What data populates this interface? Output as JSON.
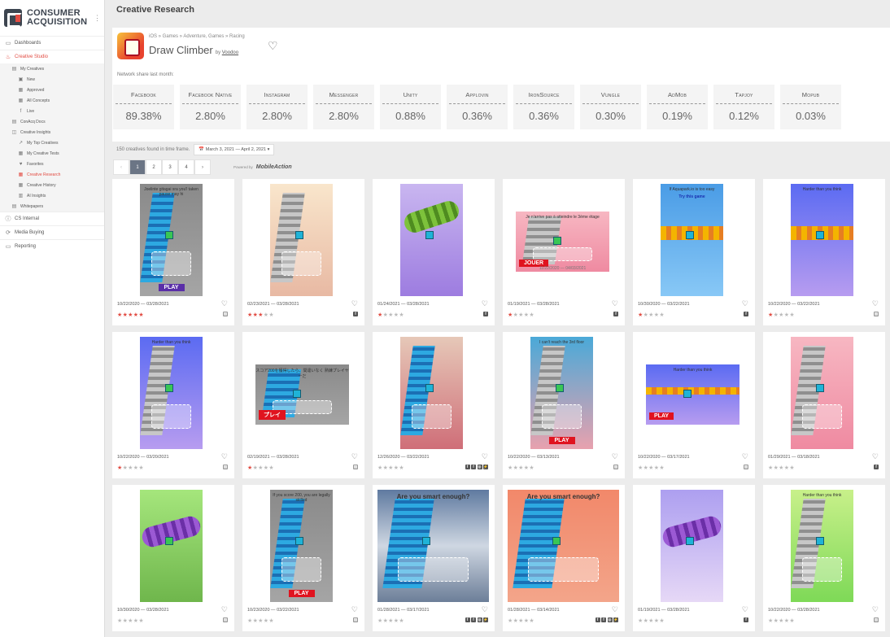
{
  "brand": {
    "line1": "CONSUMER",
    "line2": "ACQUISITION"
  },
  "nav": {
    "dashboards": "Dashboards",
    "creative_studio": "Creative Studio",
    "my_creatives": "My Creatives",
    "new": "New",
    "approved": "Approved",
    "all_concepts": "All Concepts",
    "live": "Live",
    "conacq_docs": "ConAcq Docs",
    "creative_insights": "Creative Insights",
    "my_top_creatives": "My Top Creatives",
    "my_creative_tests": "My Creative Tests",
    "favorites": "Favorites",
    "creative_research": "Creative Research",
    "creative_history": "Creative History",
    "ai_insights": "AI Insights",
    "whitepapers": "Whitepapers",
    "cs_internal": "CS Internal",
    "media_buying": "Media Buying",
    "reporting": "Reporting"
  },
  "page": {
    "title": "Creative Research"
  },
  "app": {
    "breadcrumb": "iOS » Games » Adventure, Games » Racing",
    "name": "Draw Climber",
    "by": "by",
    "developer": "Voodoo"
  },
  "network": {
    "label": "Network share last month:",
    "shares": [
      {
        "name": "Facebook",
        "value": "89.38%"
      },
      {
        "name": "Facebook Native",
        "value": "2.80%"
      },
      {
        "name": "Instagram",
        "value": "2.80%"
      },
      {
        "name": "Messenger",
        "value": "2.80%"
      },
      {
        "name": "Unity",
        "value": "0.88%"
      },
      {
        "name": "Applovin",
        "value": "0.36%"
      },
      {
        "name": "IronSource",
        "value": "0.36%"
      },
      {
        "name": "Vungle",
        "value": "0.30%"
      },
      {
        "name": "AdMob",
        "value": "0.19%"
      },
      {
        "name": "Tapjoy",
        "value": "0.12%"
      },
      {
        "name": "Mopub",
        "value": "0.03%"
      }
    ]
  },
  "results": {
    "found_text": "150 creatives found in time frame.",
    "date_range": "March 3, 2021 — April 2, 2021",
    "pages": [
      "1",
      "2",
      "3",
      "4"
    ],
    "powered_by": "Powered by",
    "powered_brand": "MobileAction"
  },
  "colors": {
    "accent": "#e24c43",
    "active_page": "#6b7585"
  },
  "creatives": [
    {
      "dates": "10/22/2020 — 03/28/2021",
      "rating": 5,
      "caption": "Joelinte gitagai sra you'l taken pause may hi",
      "play": "PLAY"
    },
    {
      "dates": "02/23/2021 — 03/28/2021",
      "rating": 3,
      "caption": ""
    },
    {
      "dates": "01/24/2021 — 03/28/2021",
      "rating": 1,
      "caption": ""
    },
    {
      "dates": "01/19/2021 — 03/28/2021",
      "rating": 1,
      "caption": "Je n'arrive pas à atteindre le 3ème étage",
      "play": "JOUER",
      "footer": "11/22/2020 — 04/03/2021"
    },
    {
      "dates": "10/30/2020 — 03/22/2021",
      "rating": 1,
      "caption": "If Aquapark.io is too easy",
      "sub": "Try this game"
    },
    {
      "dates": "10/22/2020 — 03/22/2021",
      "rating": 1,
      "caption": "Harder than you think"
    },
    {
      "dates": "10/22/2020 — 03/20/2021",
      "rating": 1,
      "caption": "Harder than you think"
    },
    {
      "dates": "02/19/2021 — 03/28/2021",
      "rating": 1,
      "caption": "スコア200を獲得したら、間違いなく 熟練プレイヤーだ",
      "play": "プレイ"
    },
    {
      "dates": "12/26/2020 — 03/22/2021",
      "rating": 0,
      "caption": ""
    },
    {
      "dates": "10/22/2020 — 03/13/2021",
      "rating": 0,
      "caption": "I can't reach the 3rd floor",
      "play": "PLAY"
    },
    {
      "dates": "10/22/2020 — 03/17/2021",
      "rating": 0,
      "caption": "Harder than you think",
      "play": "PLAY"
    },
    {
      "dates": "01/29/2021 — 03/18/2021",
      "rating": 0,
      "caption": ""
    },
    {
      "dates": "10/30/2020 — 03/28/2021",
      "rating": 0,
      "caption": ""
    },
    {
      "dates": "10/23/2020 — 03/22/2021",
      "rating": 0,
      "caption": "If you score 200, you are legally skilled",
      "play": "PLAY"
    },
    {
      "dates": "01/28/2021 — 03/17/2021",
      "rating": 0,
      "caption": "Are you smart enough?"
    },
    {
      "dates": "01/28/2021 — 03/14/2021",
      "rating": 0,
      "caption": "Are you smart enough?"
    },
    {
      "dates": "01/19/2021 — 03/28/2021",
      "rating": 0,
      "caption": ""
    },
    {
      "dates": "10/22/2020 — 03/28/2021",
      "rating": 0,
      "caption": "Harder than you think"
    }
  ]
}
